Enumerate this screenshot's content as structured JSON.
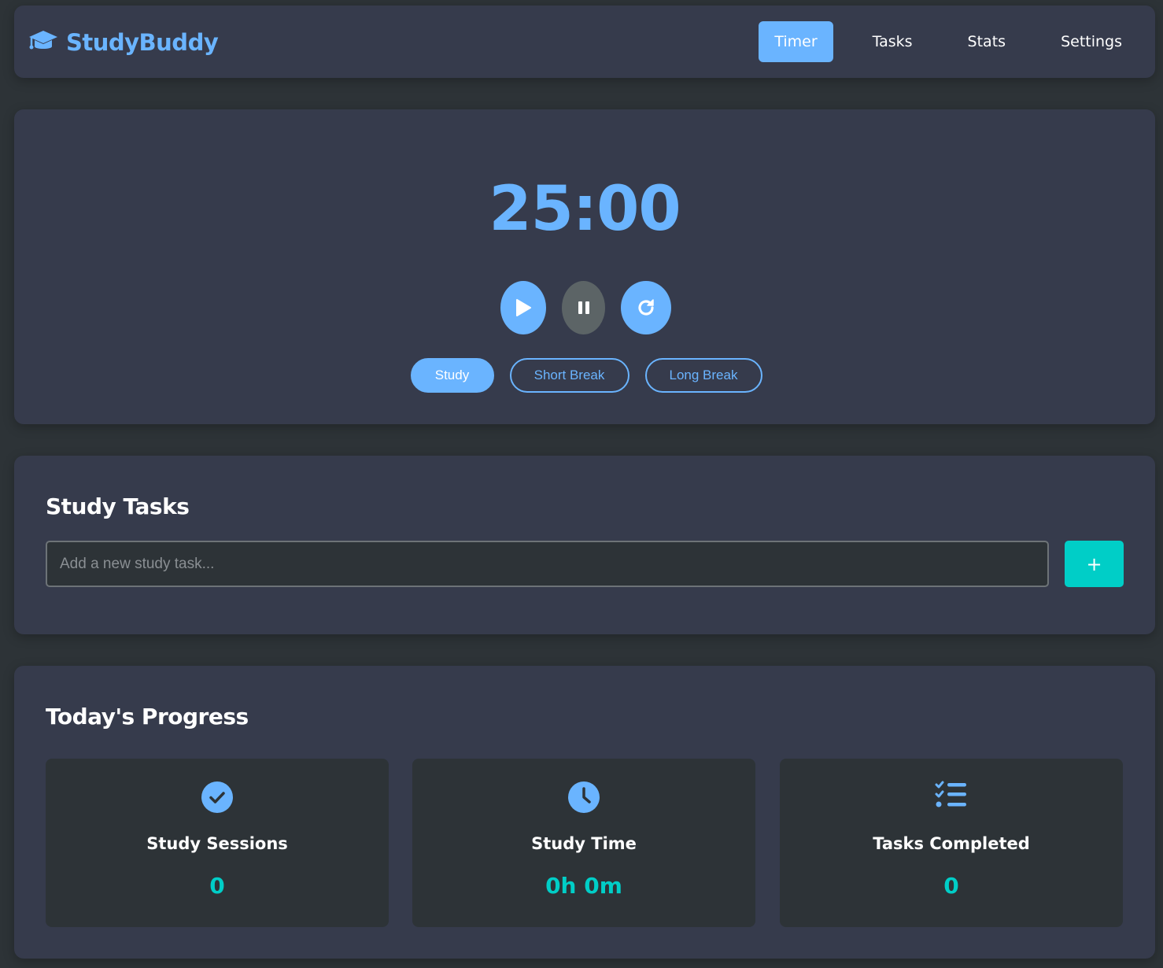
{
  "app": {
    "name": "StudyBuddy",
    "logo_icon": "graduation-cap-icon",
    "accent": "#6ab4ff",
    "teal": "#00cec7"
  },
  "nav": {
    "items": [
      {
        "label": "Timer",
        "active": true
      },
      {
        "label": "Tasks"
      },
      {
        "label": "Stats"
      },
      {
        "label": "Settings"
      }
    ]
  },
  "timer": {
    "display": "25:00",
    "controls": {
      "play": "play-icon",
      "pause": "pause-icon",
      "reset": "reset-icon"
    },
    "modes": [
      {
        "label": "Study",
        "active": true
      },
      {
        "label": "Short Break"
      },
      {
        "label": "Long Break"
      }
    ]
  },
  "tasks": {
    "title": "Study Tasks",
    "input_placeholder": "Add a new study task...",
    "input_value": "",
    "add_label": "+"
  },
  "progress": {
    "title": "Today's Progress",
    "stats": [
      {
        "icon": "check-circle-icon",
        "label": "Study Sessions",
        "value": "0"
      },
      {
        "icon": "clock-icon",
        "label": "Study Time",
        "value": "0h 0m"
      },
      {
        "icon": "task-list-icon",
        "label": "Tasks Completed",
        "value": "0"
      }
    ]
  }
}
